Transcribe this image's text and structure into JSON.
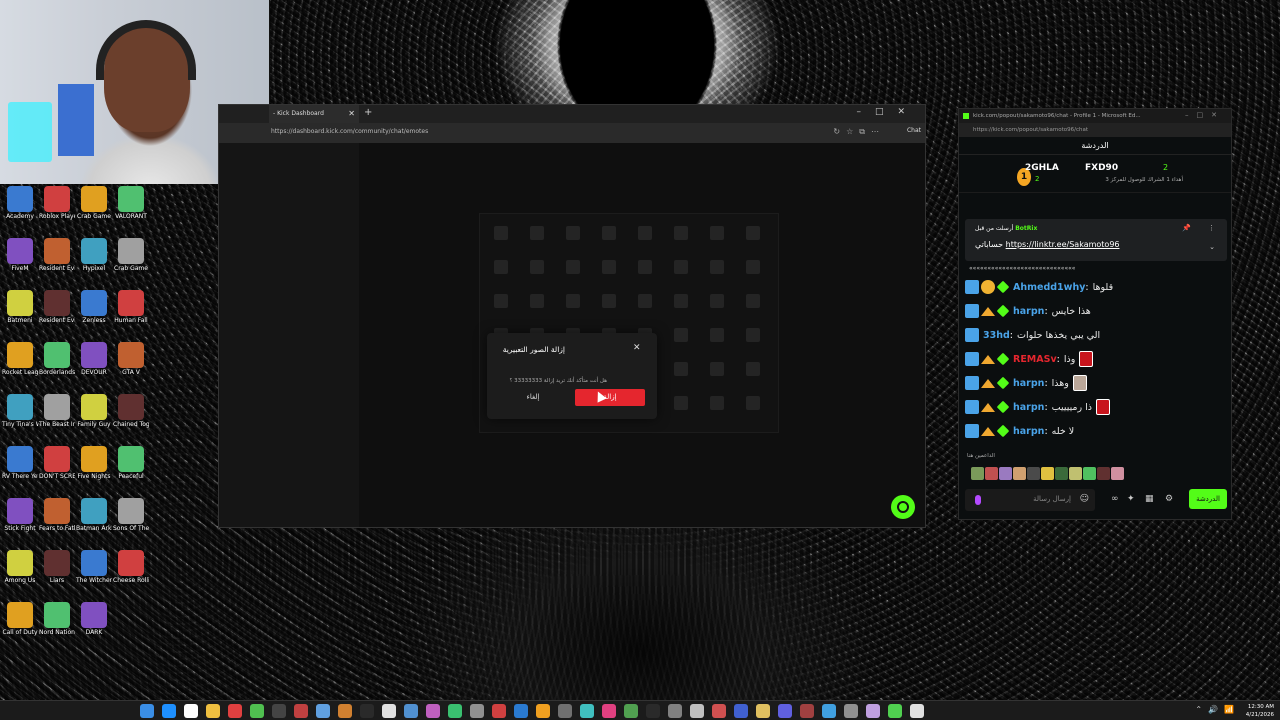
{
  "browser": {
    "tab_title": "- Kick Dashboard",
    "url": "https://dashboard.kick.com/community/chat/emotes",
    "chat_button": "Chat"
  },
  "modal": {
    "title": "إزالة الصور التعبيرية",
    "message": "هل أنت متأكد أنك تريد إزالة 33333333 ؟",
    "remove_label": "إزالة",
    "cancel_label": "إلغاء"
  },
  "chat_window": {
    "window_title": "kick.com/popout/sakamoto96/chat - Profile 1 - Microsoft Ed...",
    "url": "https://kick.com/popout/sakamoto96/chat",
    "header_title": "الدردشة",
    "leaderboard": {
      "first_name": "2GHLA",
      "first_count": "2",
      "first_rank": "1",
      "second_name": "FXD90",
      "second_count": "2",
      "subtitle": "أهداء 1 الشراك للوصول للمركز 3"
    },
    "pinned": {
      "sent_by": "أرسلت من قبل",
      "author": "BotRix",
      "label": "حساباتي",
      "link": "https://linktr.ee/Sakamoto96"
    },
    "clipped_text": "«««««««««««««««««««««««««««««",
    "messages": [
      {
        "user": "Ahmedd1why",
        "text": "قلوها",
        "color": "#4aa3e8"
      },
      {
        "user": "harpn",
        "text": "هذا خايس",
        "color": "#4aa3e8"
      },
      {
        "user": "33hd",
        "text": "الي يبي يخذها حلوات",
        "color": "#4aa3e8"
      },
      {
        "user": "REMASv",
        "text": "وذا",
        "color": "#e5262e"
      },
      {
        "user": "harpn",
        "text": "وهذا",
        "color": "#4aa3e8"
      },
      {
        "user": "harpn",
        "text": "ذا رمييييب",
        "color": "#4aa3e8"
      },
      {
        "user": "harpn",
        "text": "لا خله",
        "color": "#4aa3e8"
      }
    ],
    "supporters_label": "الداعمين هنا",
    "composer_placeholder": "إرسال رسالة",
    "send_label": "الدردشة"
  },
  "desktop_icons": [
    "Academy",
    "Roblox Player",
    "Crab Game",
    "VALORANT",
    "FiveM",
    "Resident Evil",
    "Hypixel",
    "Crab Game",
    "Batmeni",
    "Resident Evil Revelations",
    "Zenless",
    "Human Fall",
    "Rocket League",
    "Borderlands",
    "DEVOUR",
    "GTA V",
    "Tiny Tina's Wonderlands",
    "The Beast Inside",
    "Family Guy",
    "Chained Together",
    "RV There Yet",
    "DON'T SCREAM",
    "Five Nights",
    "Peaceful",
    "Stick Fight",
    "Fears to Fathom",
    "Batman Arkham",
    "Sons Of The Forest",
    "Among Us",
    "Liars",
    "The Witcher 3",
    "Cheese Rolling",
    "Call of Duty",
    "Nord Nation",
    "DARK"
  ],
  "taskbar": {
    "time": "12:30 AM",
    "date": "4/21/2026"
  },
  "colors": {
    "kick_green": "#53fc18",
    "danger_red": "#e5262e"
  }
}
